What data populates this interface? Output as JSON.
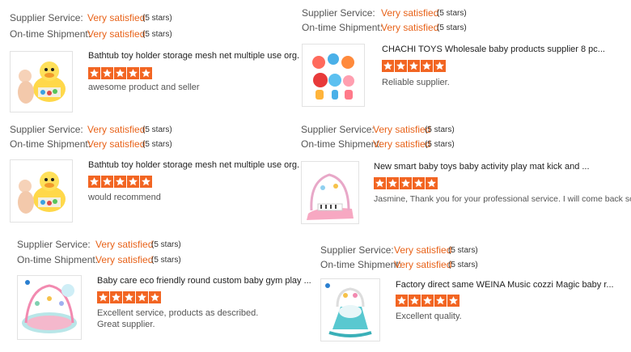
{
  "labels": {
    "supplier_service": "Supplier Service:",
    "ontime_shipment": "On-time Shipment:",
    "rating_value": "Very satisfied",
    "rating_stars": "(5 stars)"
  },
  "colors": {
    "accent": "#e8631a",
    "star": "#f26522"
  },
  "reviews": [
    {
      "product": "Bathtub toy holder storage mesh net multiple use org.",
      "stars": 5,
      "comment": "awesome product and seller",
      "thumb_icon": "duck-bath-organizer-image"
    },
    {
      "product": "CHACHI TOYS Wholesale baby products supplier 8 pc...",
      "stars": 5,
      "comment": "Reliable supplier.",
      "thumb_icon": "baby-rattle-set-image"
    },
    {
      "product": "Bathtub toy holder storage mesh net multiple use org.",
      "stars": 5,
      "comment": "would recommend",
      "thumb_icon": "duck-bath-organizer-image"
    },
    {
      "product": "New smart baby toys baby activity play mat kick and ...",
      "stars": 5,
      "comment": "Jasmine, Thank you for your professional service. I will come back soon!",
      "thumb_icon": "piano-play-mat-image"
    },
    {
      "product": "Baby care eco friendly round custom baby gym play ...",
      "stars": 5,
      "comment": "Excellent service, products as described.",
      "comment2": "Great supplier.",
      "thumb_icon": "round-play-gym-image"
    },
    {
      "product": "Factory direct same WEINA Music cozzi Magic baby r...",
      "stars": 5,
      "comment": "Excellent quality.",
      "thumb_icon": "baby-rocker-image"
    }
  ]
}
